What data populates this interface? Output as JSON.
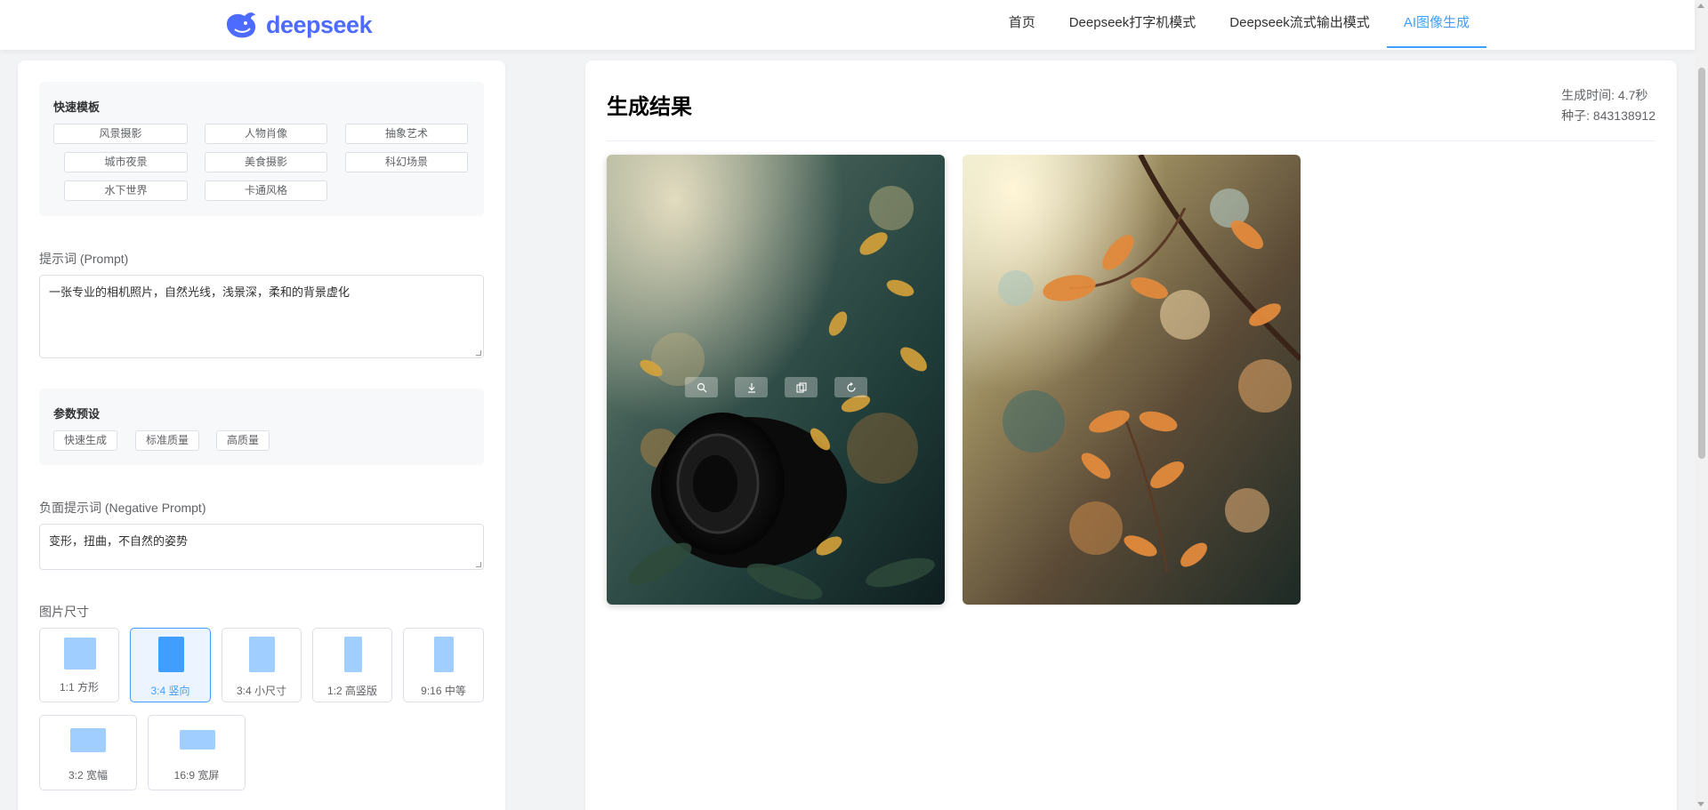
{
  "header": {
    "logo_text": "deepseek",
    "nav": [
      {
        "label": "首页",
        "active": false
      },
      {
        "label": "Deepseek打字机模式",
        "active": false
      },
      {
        "label": "Deepseek流式输出模式",
        "active": false
      },
      {
        "label": "AI图像生成",
        "active": true
      }
    ]
  },
  "templates": {
    "title": "快速模板",
    "items": [
      "风景摄影",
      "人物肖像",
      "抽象艺术",
      "城市夜景",
      "美食摄影",
      "科幻场景",
      "水下世界",
      "卡通风格"
    ]
  },
  "prompt": {
    "label": "提示词 (Prompt)",
    "value": "一张专业的相机照片，自然光线，浅景深，柔和的背景虚化"
  },
  "presets": {
    "title": "参数预设",
    "items": [
      "快速生成",
      "标准质量",
      "高质量"
    ]
  },
  "negative_prompt": {
    "label": "负面提示词 (Negative Prompt)",
    "value": "变形，扭曲，不自然的姿势"
  },
  "image_size": {
    "label": "图片尺寸",
    "options": [
      {
        "label": "1:1 方形",
        "selected": false
      },
      {
        "label": "3:4 竖向",
        "selected": true
      },
      {
        "label": "3:4 小尺寸",
        "selected": false
      },
      {
        "label": "1:2 高竖版",
        "selected": false
      },
      {
        "label": "9:16 中等",
        "selected": false
      },
      {
        "label": "3:2 宽幅",
        "selected": false
      },
      {
        "label": "16:9 宽屏",
        "selected": false
      }
    ]
  },
  "result": {
    "title": "生成结果",
    "time": "生成时间: 4.7秒",
    "seed": "种子: 843138912",
    "images": [
      {
        "description": "相机镜头与秋叶虚化背景"
      },
      {
        "description": "阳光下的橙色树叶与光斑"
      }
    ],
    "actions": [
      "zoom-in-icon",
      "download-icon",
      "copy-icon",
      "refresh-icon"
    ]
  },
  "colors": {
    "accent": "#409eff",
    "brand": "#4d6bfe"
  }
}
